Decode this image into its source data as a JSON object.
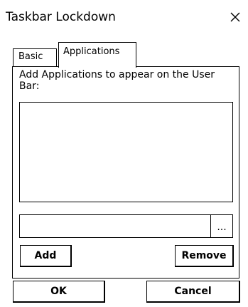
{
  "window": {
    "title": "Taskbar Lockdown",
    "close_glyph": "×"
  },
  "tabs": [
    {
      "label": "Basic",
      "selected": false
    },
    {
      "label": "Applications",
      "selected": true
    }
  ],
  "applications_tab": {
    "instruction": "Add Applications to appear on the User Bar:",
    "app_list_items": [],
    "path_input": {
      "value": "",
      "placeholder": ""
    },
    "browse_label": "...",
    "add_label": "Add",
    "remove_label": "Remove"
  },
  "dialog_buttons": {
    "ok_label": "OK",
    "cancel_label": "Cancel"
  }
}
